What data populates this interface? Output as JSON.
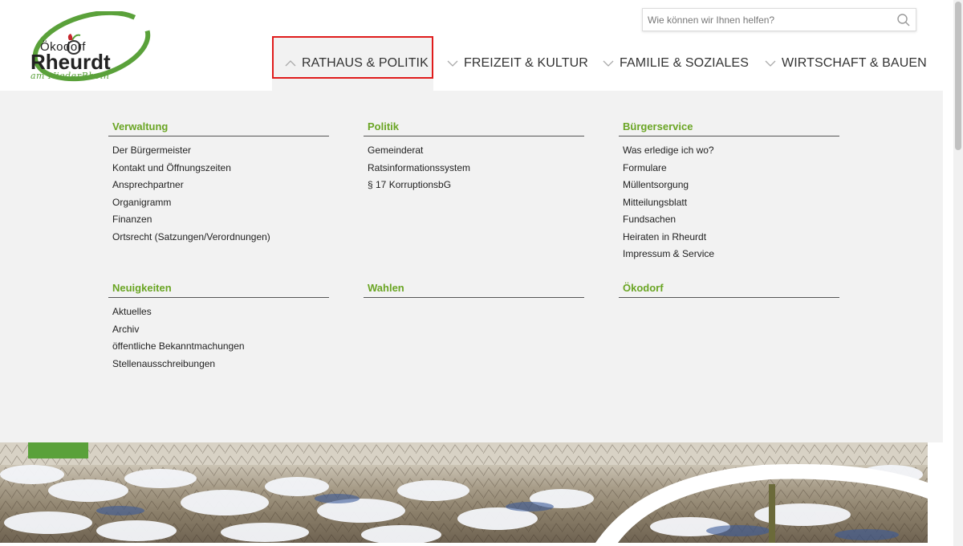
{
  "logo": {
    "top_line": "Ökodorf",
    "name": "Rheurdt",
    "tagline": "am NiederRhein",
    "ring_color": "#5aa13a",
    "apple_color": "#c6252c"
  },
  "search": {
    "placeholder": "Wie können wir Ihnen helfen?",
    "icon": "search-icon"
  },
  "nav": {
    "items": [
      {
        "label": "RATHAUS & POLITIK",
        "active": true,
        "icon": "chevron-up-icon"
      },
      {
        "label": "FREIZEIT & KULTUR",
        "active": false,
        "icon": "chevron-down-icon"
      },
      {
        "label": "FAMILIE & SOZIALES",
        "active": false,
        "icon": "chevron-down-icon"
      },
      {
        "label": "WIRTSCHAFT & BAUEN",
        "active": false,
        "icon": "chevron-down-icon"
      }
    ],
    "highlight_color": "#e01c1c"
  },
  "mega_menu": {
    "accent_color": "#6aa524",
    "sections": [
      {
        "title": "Verwaltung",
        "links": [
          "Der Bürgermeister",
          "Kontakt und Öffnungszeiten",
          "Ansprechpartner",
          "Organigramm",
          "Finanzen",
          "Ortsrecht (Satzungen/Verordnungen)"
        ]
      },
      {
        "title": "Politik",
        "links": [
          "Gemeinderat",
          "Ratsinformationssystem",
          "§ 17 KorruptionsbG"
        ]
      },
      {
        "title": "Bürgerservice",
        "links": [
          "Was erledige ich wo?",
          "Formulare",
          "Müllentsorgung",
          "Mitteilungsblatt",
          "Fundsachen",
          "Heiraten in Rheurdt",
          "Impressum & Service"
        ]
      },
      {
        "title": "Neuigkeiten",
        "links": [
          "Aktuelles",
          "Archiv",
          "öffentliche Bekanntmachungen",
          "Stellenausschreibungen"
        ]
      },
      {
        "title": "Wahlen",
        "links": []
      },
      {
        "title": "Ökodorf",
        "links": []
      }
    ]
  }
}
